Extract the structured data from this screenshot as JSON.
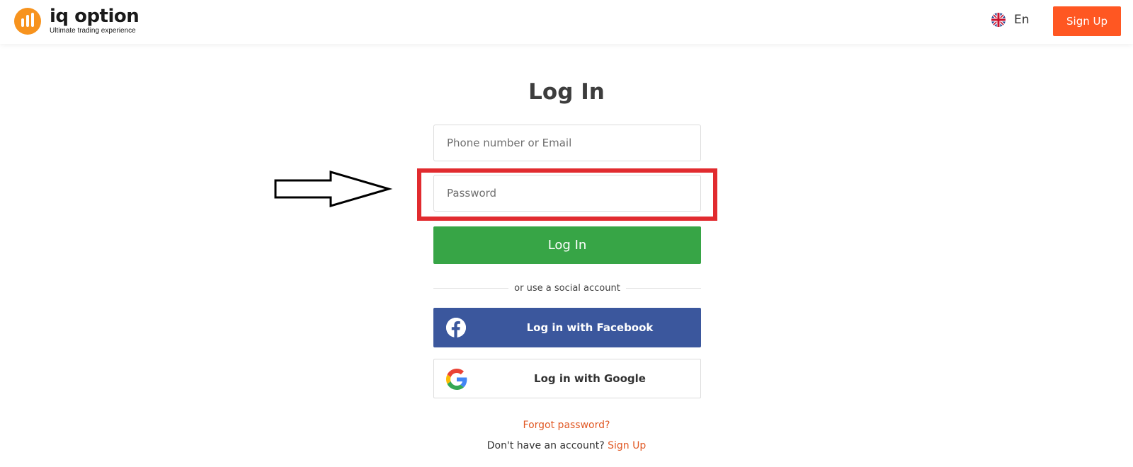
{
  "header": {
    "logo_name": "iq option",
    "logo_tagline": "Ultimate trading experience",
    "language": "En",
    "signup_label": "Sign Up"
  },
  "form": {
    "title": "Log In",
    "email_placeholder": "Phone number or Email",
    "password_placeholder": "Password",
    "login_label": "Log In",
    "divider_text": "or use a social account",
    "facebook_label": "Log in with Facebook",
    "google_label": "Log in with Google",
    "forgot_label": "Forgot password?",
    "no_account_text": "Don't have an account?",
    "signup_link": "Sign Up"
  },
  "colors": {
    "brand_orange": "#f7931e",
    "signup_orange": "#ff5722",
    "login_green": "#37a546",
    "facebook_blue": "#3b579d",
    "highlight_red": "#e12b2f",
    "link_orange": "#e15a26"
  },
  "icons": [
    "iq-option-logo-icon",
    "uk-flag-icon",
    "facebook-icon",
    "google-icon",
    "arrow-icon"
  ]
}
